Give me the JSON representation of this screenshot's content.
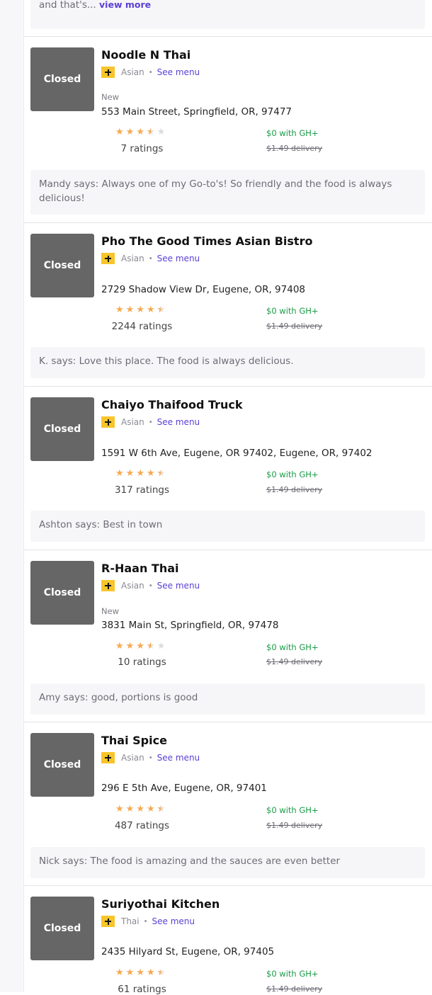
{
  "top_review": {
    "text": "and that's...",
    "view_more": "view more"
  },
  "common": {
    "closed": "Closed",
    "see_menu": "See menu",
    "gh_offer": "$0 with GH+",
    "delivery_fee": "$1.49 delivery",
    "new_tag": "New",
    "star_color": "#f6a94f",
    "offer_color": "#1a9b47",
    "link_color": "#5b3fd6"
  },
  "restaurants": [
    {
      "name": "Noodle N Thai",
      "cuisine": "Asian",
      "is_new": true,
      "address": "553 Main Street, Springfield, OR, 97477",
      "rating": 3.5,
      "ratings": "7 ratings",
      "review": "Mandy says: Always one of my Go-to's! So friendly and the food is always delicious!"
    },
    {
      "name": "Pho The Good Times Asian Bistro",
      "cuisine": "Asian",
      "is_new": false,
      "address": "2729 Shadow View Dr, Eugene, OR, 97408",
      "rating": 4.5,
      "ratings": "2244 ratings",
      "review": "K. says: Love this place. The food is always delicious."
    },
    {
      "name": "Chaiyo Thaifood Truck",
      "cuisine": "Asian",
      "is_new": false,
      "address": "1591 W 6th Ave, Eugene, OR 97402, Eugene, OR, 97402",
      "rating": 4.5,
      "ratings": "317 ratings",
      "review": "Ashton says: Best in town"
    },
    {
      "name": "R-Haan Thai",
      "cuisine": "Asian",
      "is_new": true,
      "address": "3831 Main St, Springfield, OR, 97478",
      "rating": 3.5,
      "ratings": "10 ratings",
      "review": "Amy says: good, portions is good"
    },
    {
      "name": "Thai Spice",
      "cuisine": "Asian",
      "is_new": false,
      "address": "296 E 5th Ave, Eugene, OR, 97401",
      "rating": 4.5,
      "ratings": "487 ratings",
      "review": "Nick says: The food is amazing and the sauces are even better"
    },
    {
      "name": "Suriyothai Kitchen",
      "cuisine": "Thai",
      "is_new": false,
      "address": "2435 Hilyard St, Eugene, OR, 97405",
      "rating": 4.5,
      "ratings": "61 ratings",
      "review": ""
    }
  ]
}
